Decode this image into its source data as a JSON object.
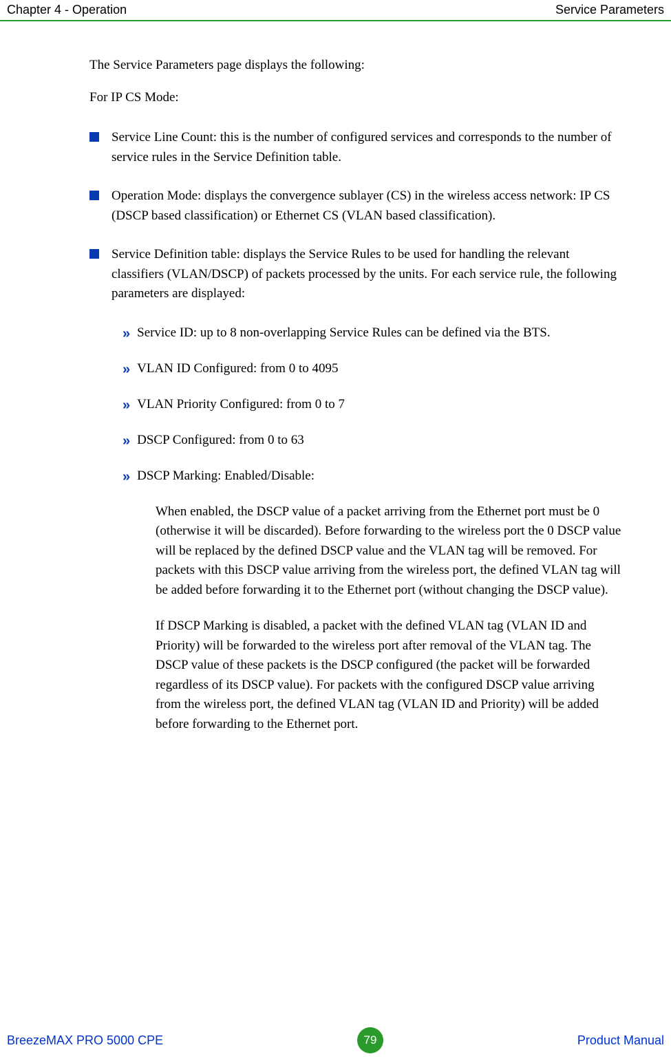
{
  "header": {
    "left": "Chapter 4 - Operation",
    "right": "Service Parameters"
  },
  "body": {
    "intro": "The Service Parameters page displays the following:",
    "mode_line": "For IP CS Mode:",
    "bullets": [
      "Service Line Count: this is the number of configured services and corresponds to the number of service rules in the Service Definition table.",
      "Operation Mode: displays the convergence sublayer (CS) in the wireless access network: IP CS (DSCP based classification) or Ethernet CS (VLAN based classification).",
      "Service Definition table: displays the Service Rules to be used for handling the relevant classifiers (VLAN/DSCP) of packets processed by the units. For each service rule, the following parameters are displayed:"
    ],
    "sub_bullets": [
      "Service ID: up to 8 non-overlapping Service Rules can be defined via the BTS.",
      "VLAN ID Configured: from 0 to 4095",
      "VLAN Priority Configured: from 0 to 7",
      "DSCP Configured: from 0 to 63",
      "DSCP Marking: Enabled/Disable:"
    ],
    "sub_paras": [
      "When enabled, the DSCP value of a packet arriving from the Ethernet port must be 0 (otherwise it will be discarded). Before forwarding to the wireless port the 0 DSCP value will be replaced by the defined DSCP value and the VLAN tag will be removed. For packets with this DSCP value arriving from the wireless port, the defined VLAN tag will be added before forwarding it to the Ethernet port (without changing the DSCP value).",
      "If DSCP Marking is disabled, a packet with the defined VLAN tag (VLAN ID and Priority) will be forwarded to the wireless port after removal of the VLAN tag. The DSCP value of these packets is the DSCP configured (the packet will be forwarded regardless of its DSCP value). For packets with the configured DSCP value arriving from the wireless port, the defined VLAN tag (VLAN ID and Priority) will be added before forwarding to the Ethernet port."
    ]
  },
  "footer": {
    "left": "BreezeMAX PRO 5000 CPE",
    "page": "79",
    "right": "Product Manual"
  }
}
